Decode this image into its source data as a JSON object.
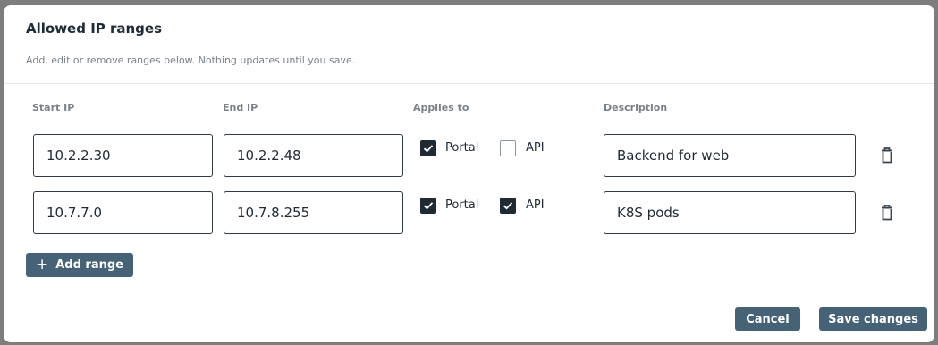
{
  "dialog": {
    "title": "Allowed IP ranges",
    "subtitle": "Add, edit or remove ranges below. Nothing updates until you save."
  },
  "columns": {
    "start_ip": "Start IP",
    "end_ip": "End IP",
    "applies_to": "Applies to",
    "description": "Description"
  },
  "rows": [
    {
      "start_ip": "10.2.2.30",
      "end_ip": "10.2.2.48",
      "portal_label": "Portal",
      "portal_checked": true,
      "api_label": "API",
      "api_checked": false,
      "description": "Backend for web"
    },
    {
      "start_ip": "10.7.7.0",
      "end_ip": "10.7.8.255",
      "portal_label": "Portal",
      "portal_checked": true,
      "api_label": "API",
      "api_checked": true,
      "description": "K8S pods"
    }
  ],
  "actions": {
    "add_range_icon": "+",
    "add_range": "Add range",
    "cancel": "Cancel",
    "save": "Save changes"
  },
  "icons": {
    "delete": "trash-icon",
    "check": "checkmark-icon"
  },
  "colors": {
    "primary_button": "#456276",
    "checkbox_checked": "#1f2a33",
    "overlay": "#7d7d7d"
  }
}
